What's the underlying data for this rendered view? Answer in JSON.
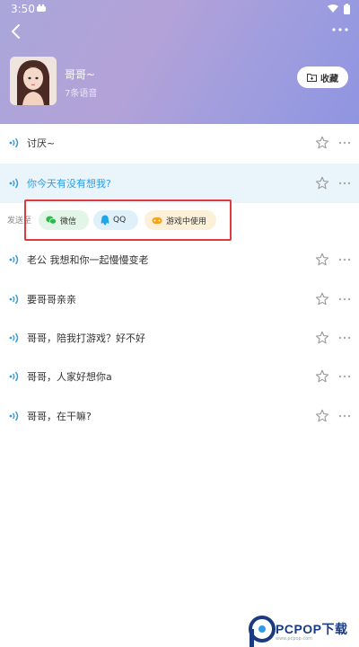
{
  "status_bar": {
    "time": "3:50"
  },
  "header": {
    "profile_name": "哥哥~",
    "voice_count": "7条语音",
    "favorite_label": "收藏"
  },
  "voices": [
    {
      "text": "讨厌~"
    },
    {
      "text": "你今天有没有想我?"
    },
    {
      "text": "老公 我想和你一起慢慢变老"
    },
    {
      "text": "要哥哥亲亲"
    },
    {
      "text": "哥哥，陪我打游戏？好不好"
    },
    {
      "text": "哥哥，人家好想你a"
    },
    {
      "text": "哥哥，在干嘛?"
    }
  ],
  "share": {
    "label": "发送至",
    "wechat": "微信",
    "qq": "QQ",
    "game": "游戏中使用"
  },
  "watermark": {
    "brand": "PCPOP下载",
    "sub": "www.pcpop.com"
  },
  "colors": {
    "accent": "#2f9de3",
    "highlight_bg": "#eaf4fb",
    "annotation_red": "#e0393e",
    "header_gradient_start": "#a9a6da",
    "header_gradient_end": "#8f95e0"
  }
}
